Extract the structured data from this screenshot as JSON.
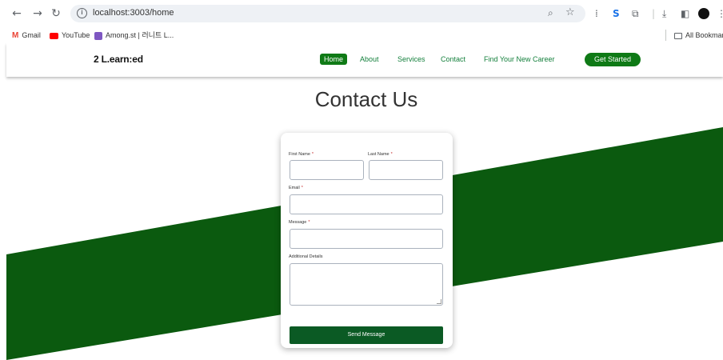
{
  "browser": {
    "url": "localhost:3003/home",
    "nav_icons": [
      "back-arrow-icon",
      "forward-arrow-icon",
      "reload-icon"
    ],
    "bookmarks": [
      {
        "label": "Gmail",
        "icon": "gmail-icon",
        "color": "#ea4335"
      },
      {
        "label": "YouTube",
        "icon": "youtube-icon",
        "color": "#ff0000"
      },
      {
        "label": "Among.st | 러니트 L...",
        "icon": "among-icon",
        "color": "#7e57c2"
      }
    ],
    "all_bookmarks_label": "All Bookmarks"
  },
  "site": {
    "logo": "2 L.earn:ed",
    "nav": [
      {
        "label": "Home",
        "active": true
      },
      {
        "label": "About",
        "active": false
      },
      {
        "label": "Services",
        "active": false
      },
      {
        "label": "Contact",
        "active": false
      },
      {
        "label": "Find Your New Career",
        "active": false
      }
    ],
    "cta": "Get Started",
    "accent": "#0f7a16",
    "band_color": "#0b5a0f"
  },
  "main": {
    "title": "Contact Us"
  },
  "form": {
    "first_name_label": "First Name",
    "last_name_label": "Last Name",
    "email_label": "Email",
    "message_label": "Message",
    "details_label": "Additional Details",
    "required_mark": "*",
    "submit_label": "Send Message"
  }
}
